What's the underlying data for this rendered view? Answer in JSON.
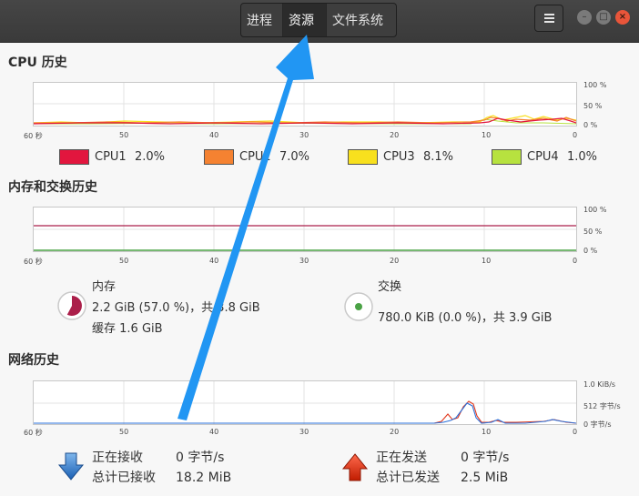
{
  "tabs": [
    "进程",
    "资源",
    "文件系统"
  ],
  "active_tab": 1,
  "window_controls": {
    "minimize": "–",
    "maximize": "□",
    "close": "×"
  },
  "cpu": {
    "title": "CPU 历史",
    "x_ticks": [
      "60 秒",
      "50",
      "40",
      "30",
      "20",
      "10",
      "0"
    ],
    "y_ticks": [
      "100 %",
      "50 %",
      "0 %"
    ],
    "legend": [
      {
        "name": "CPU1",
        "value": "2.0%",
        "color": "#e2163e"
      },
      {
        "name": "CPU2",
        "value": "7.0%",
        "color": "#f58231"
      },
      {
        "name": "CPU3",
        "value": "8.1%",
        "color": "#f8e01e"
      },
      {
        "name": "CPU4",
        "value": "1.0%",
        "color": "#b7e23f"
      }
    ]
  },
  "memory": {
    "title": "内存和交换历史",
    "x_ticks": [
      "60 秒",
      "50",
      "40",
      "30",
      "20",
      "10",
      "0"
    ],
    "y_ticks": [
      "100 %",
      "50 %",
      "0 %"
    ],
    "mem_label": "内存",
    "mem_line": "2.2 GiB (57.0 %)，共 3.8 GiB",
    "cache_line": "缓存 1.6 GiB",
    "mem_color": "#ab1f4a",
    "swap_label": "交换",
    "swap_line": "780.0 KiB (0.0 %)，共 3.9 GiB",
    "swap_color": "#4aa245"
  },
  "network": {
    "title": "网络历史",
    "x_ticks": [
      "60 秒",
      "50",
      "40",
      "30",
      "20",
      "10",
      "0"
    ],
    "y_ticks": [
      "1.0 KiB/s",
      "512 字节/s",
      "0 字节/s"
    ],
    "recv_label": "正在接收",
    "recv_rate": "0 字节/s",
    "recv_total_label": "总计已接收",
    "recv_total": "18.2 MiB",
    "send_label": "正在发送",
    "send_rate": "0 字节/s",
    "send_total_label": "总计已发送",
    "send_total": "2.5 MiB",
    "recv_color": "#2a6fd8",
    "send_color": "#e23a1f"
  },
  "annotation_color": "#2196f3"
}
